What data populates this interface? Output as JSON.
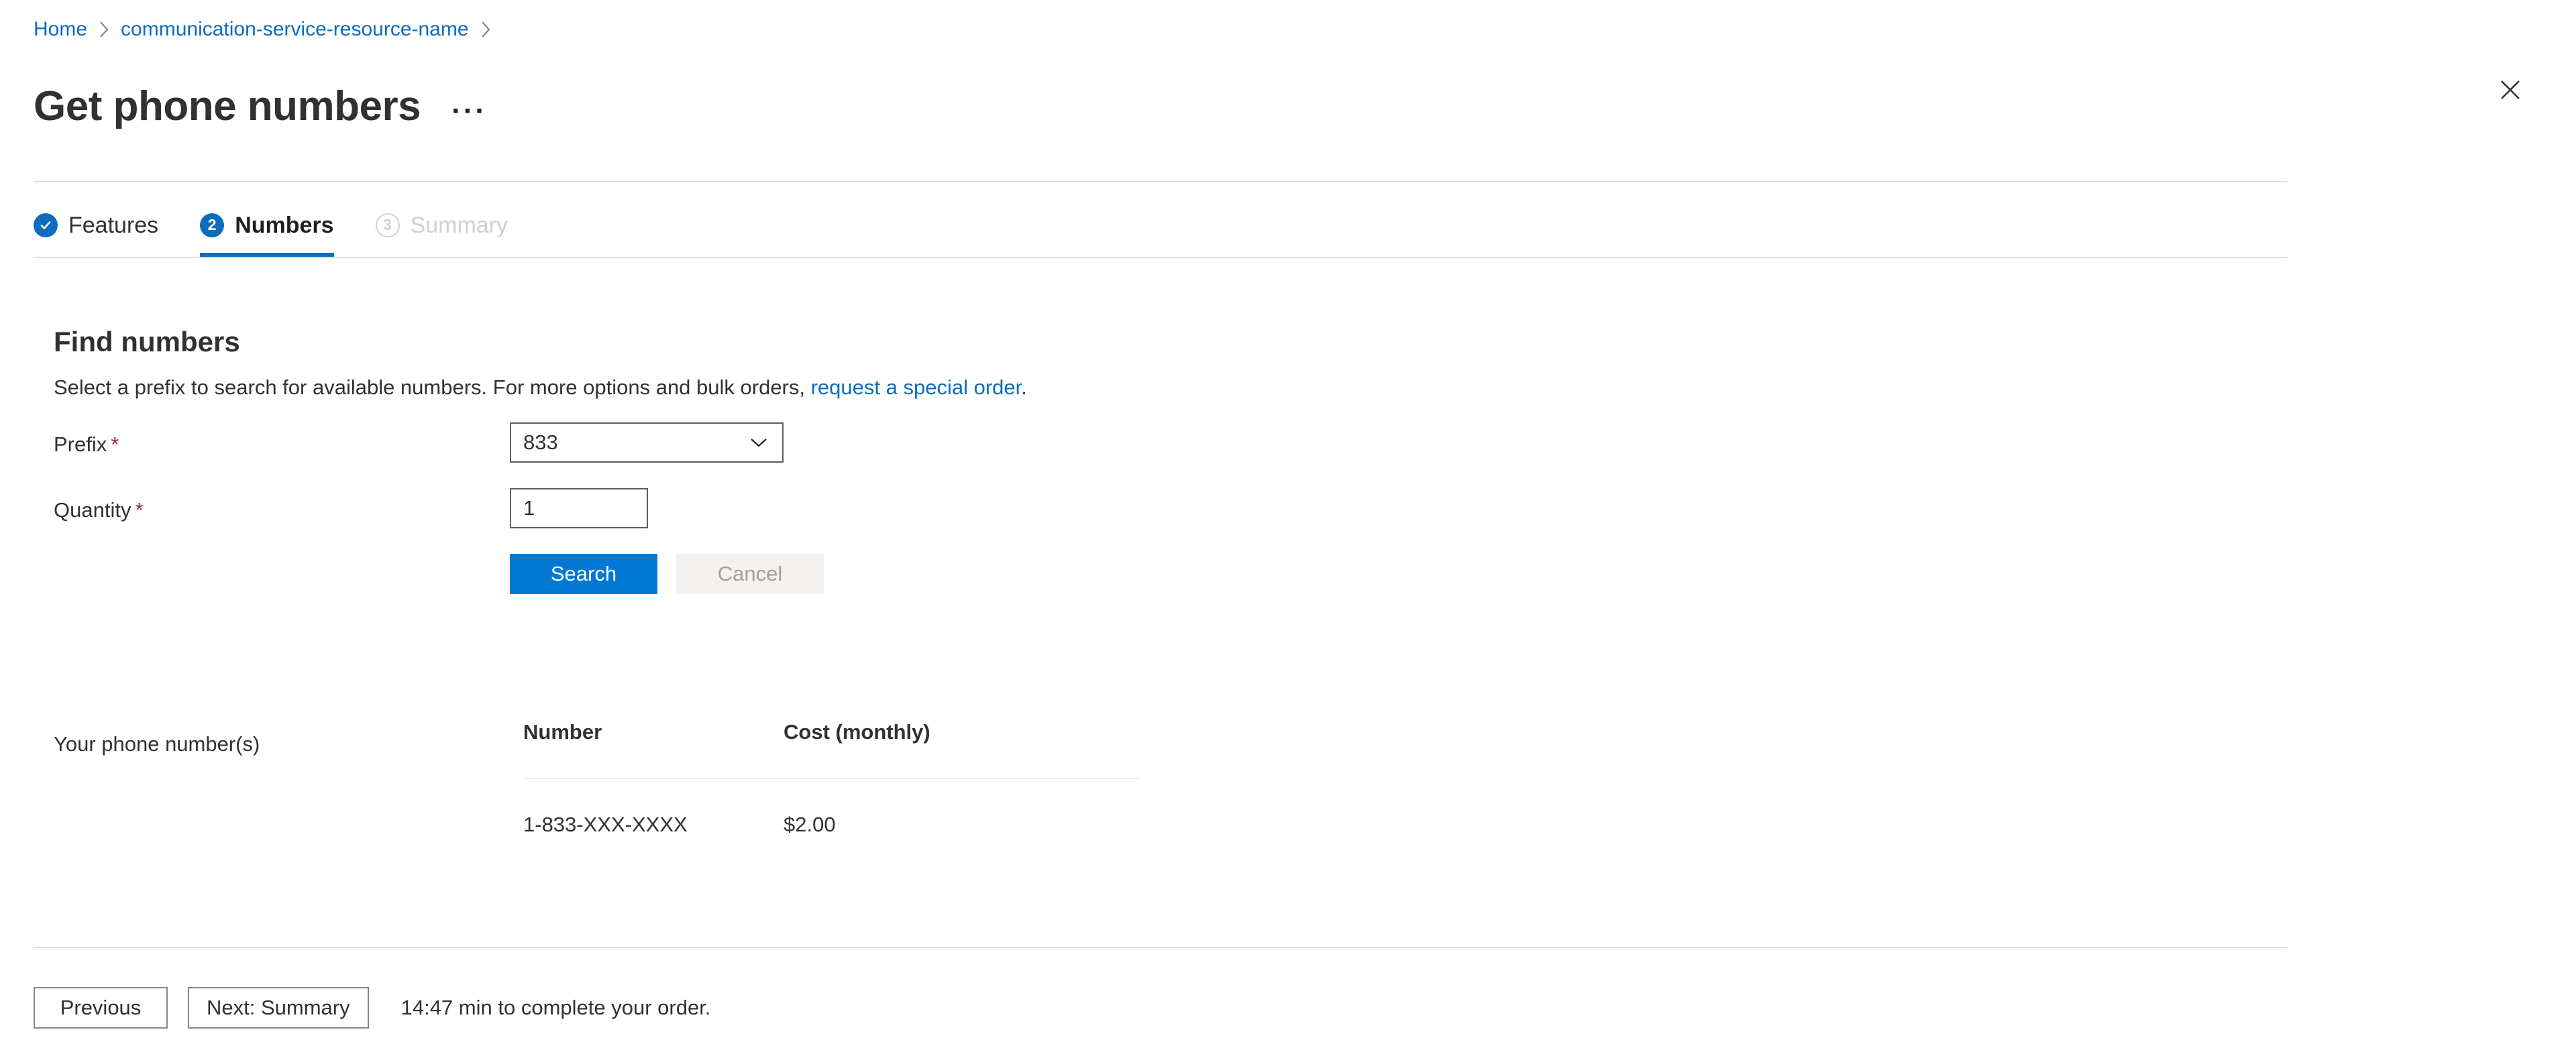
{
  "breadcrumb": {
    "items": [
      {
        "label": "Home"
      },
      {
        "label": "communication-service-resource-name"
      }
    ],
    "separator_icon": "chevron-right-icon"
  },
  "header": {
    "title": "Get phone numbers",
    "more_label": "···",
    "close_icon": "close-icon"
  },
  "tabs": [
    {
      "label": "Features",
      "badge": "✓",
      "state": "completed"
    },
    {
      "label": "Numbers",
      "badge": "2",
      "state": "current"
    },
    {
      "label": "Summary",
      "badge": "3",
      "state": "disabled"
    }
  ],
  "main": {
    "section_title": "Find numbers",
    "description_before": "Select a prefix to search for available numbers. For more options and bulk orders, ",
    "description_link": "request a special order",
    "description_after": ".",
    "form": {
      "prefix_label": "Prefix",
      "prefix_value": "833",
      "prefix_chevron_icon": "chevron-down-icon",
      "quantity_label": "Quantity",
      "quantity_value": "1",
      "required_mark": "*",
      "search_label": "Search",
      "cancel_label": "Cancel"
    },
    "results": {
      "label": "Your phone number(s)",
      "columns": [
        "Number",
        "Cost (monthly)"
      ],
      "rows": [
        {
          "number": "1-833-XXX-XXXX",
          "cost": "$2.00"
        }
      ]
    }
  },
  "footer": {
    "previous_label": "Previous",
    "next_label": "Next: Summary",
    "note": "14:47 min to complete your order."
  },
  "colors": {
    "accent": "#0078d4",
    "link": "#0f6cbd",
    "required": "#a4262c",
    "text": "#323130",
    "disabled_text": "#a19f9d",
    "divider": "#e1dfdd"
  }
}
